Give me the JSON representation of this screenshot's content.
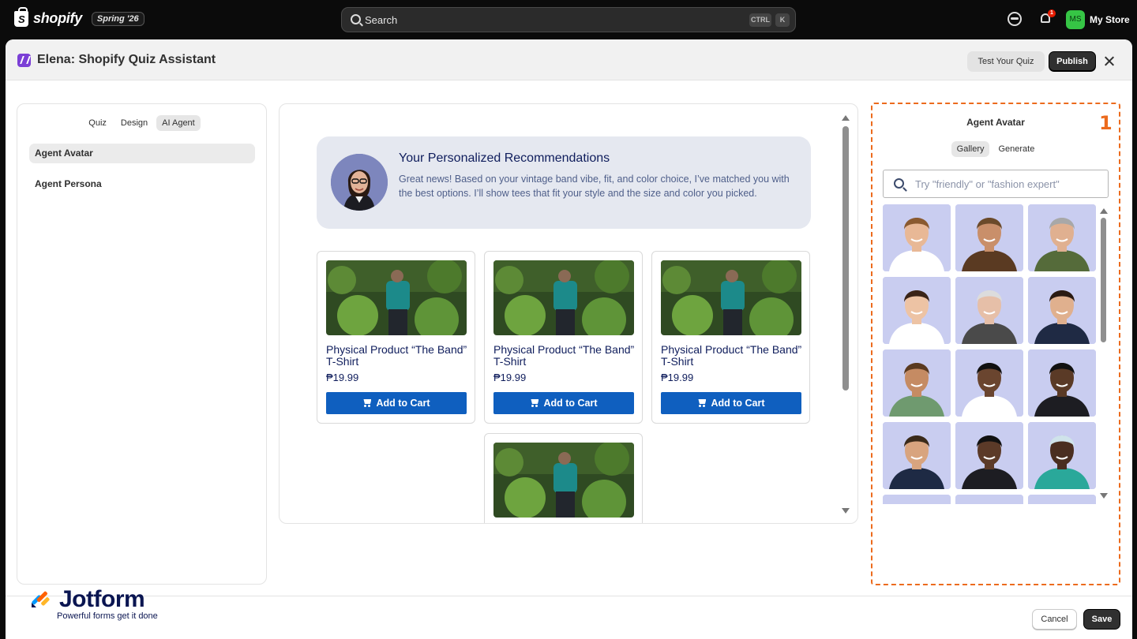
{
  "topbar": {
    "brand": "shopify",
    "brand_mark": "S",
    "edition": "Spring '26",
    "search_placeholder": "Search",
    "shortcut_1": "CTRL",
    "shortcut_2": "K",
    "notification_count": "1",
    "store_initials": "MS",
    "store_name": "My Store"
  },
  "modal": {
    "title": "Elena: Shopify Quiz Assistant",
    "test_button": "Test Your Quiz",
    "publish_button": "Publish"
  },
  "left_panel": {
    "tabs": [
      "Quiz",
      "Design",
      "AI Agent"
    ],
    "active_tab": "AI Agent",
    "items": [
      "Agent Avatar",
      "Agent Persona"
    ]
  },
  "preview": {
    "rec_title": "Your Personalized Recommendations",
    "rec_text": "Great news! Based on your vintage band vibe, fit, and color choice, I’ve matched you with the best options. I’ll show tees that fit your style and the size and color you picked.",
    "products": [
      {
        "title": "Physical Product “The Band” T-Shirt",
        "price": "₱19.99",
        "button": "Add to Cart"
      },
      {
        "title": "Physical Product “The Band” T-Shirt",
        "price": "₱19.99",
        "button": "Add to Cart"
      },
      {
        "title": "Physical Product “The Band” T-Shirt",
        "price": "₱19.99",
        "button": "Add to Cart"
      },
      {
        "title": "",
        "price": "",
        "button": ""
      }
    ]
  },
  "right_panel": {
    "title": "Agent Avatar",
    "marker": "1",
    "tabs": [
      "Gallery",
      "Generate"
    ],
    "active_tab": "Gallery",
    "search_placeholder": "Try \"friendly\" or \"fashion expert\"",
    "avatars": [
      "business-man-avatar",
      "cowboy-hat-man-avatar",
      "hiker-man-avatar",
      "smiling-woman-avatar",
      "elderly-man-avatar",
      "suit-man-glasses-avatar",
      "teacher-woman-avatar",
      "doctor-man-avatar",
      "business-woman-avatar",
      "smiling-man-suit-avatar",
      "professional-woman-avatar",
      "nurse-woman-avatar"
    ]
  },
  "footer": {
    "logo_text": "Jotform",
    "logo_tagline": "Powerful forms get it done",
    "cancel_button": "Cancel",
    "save_button": "Save"
  },
  "colors": {
    "accent": "#0f5fbf",
    "highlight_border": "#ec6b1d",
    "dark_button": "#303030",
    "rec_card_bg": "#e5e8f0"
  }
}
